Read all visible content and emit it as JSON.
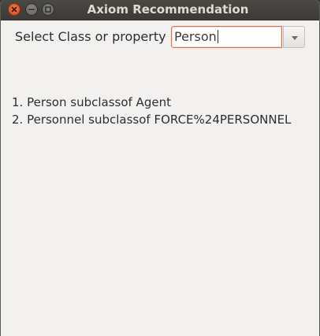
{
  "window": {
    "title": "Axiom Recommendation"
  },
  "form": {
    "label": "Select Class or property",
    "combo_value": "Person"
  },
  "results": [
    "1. Person subclassof Agent",
    "2. Personnel subclassof FORCE%24PERSONNEL"
  ],
  "icons": {
    "close": "close-icon",
    "minimize": "minimize-icon",
    "maximize": "maximize-icon",
    "dropdown": "chevron-down-icon"
  }
}
